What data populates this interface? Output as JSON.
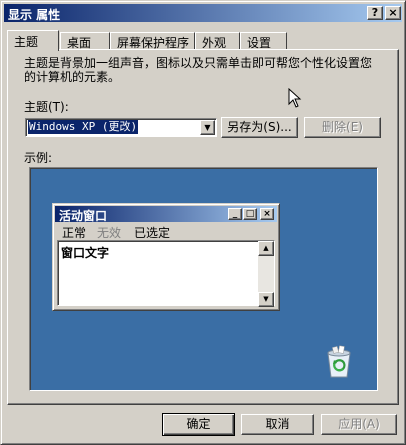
{
  "window": {
    "title": "显示 属性",
    "help_button": "?",
    "close_button": "×"
  },
  "tabs": [
    {
      "label": "主题",
      "active": true
    },
    {
      "label": "桌面",
      "active": false
    },
    {
      "label": "屏幕保护程序",
      "active": false
    },
    {
      "label": "外观",
      "active": false
    },
    {
      "label": "设置",
      "active": false
    }
  ],
  "theme_page": {
    "description": "主题是背景加一组声音，图标以及只需单击即可帮您个性化设置您的计算机的元素。",
    "theme_label": "主题(T):",
    "theme_value": "Windows XP (更改)",
    "save_as_button": "另存为(S)...",
    "delete_button": "删除(E)",
    "sample_label": "示例:"
  },
  "preview": {
    "window_title": "活动窗口",
    "menu": {
      "normal": "正常",
      "disabled": "无效",
      "selected": "已选定"
    },
    "window_text": "窗口文字",
    "desktop_color": "#3a6ea5"
  },
  "footer": {
    "ok": "确定",
    "cancel": "取消",
    "apply": "应用(A)"
  },
  "colors": {
    "title_bar_start": "#0a246a",
    "title_bar_end": "#a6caf0",
    "face": "#d4d0c8"
  }
}
